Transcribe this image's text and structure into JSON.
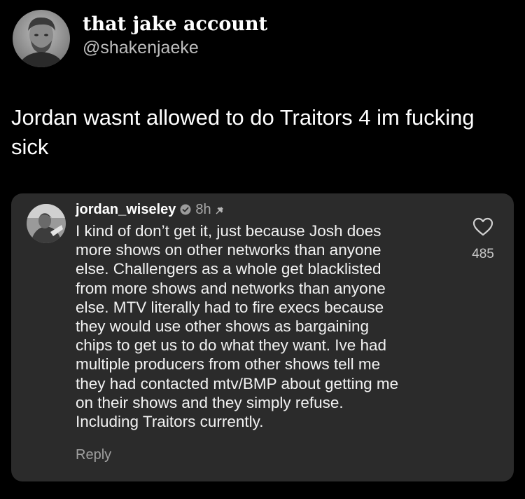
{
  "tweet": {
    "display_name": "that jake account",
    "handle": "@shakenjaeke",
    "text_lines": [
      "Jordan wasnt allowed to do Traitors 4 im fucking",
      "sick"
    ]
  },
  "comment": {
    "username": "jordan_wiseley",
    "verified_icon": "verified-badge-icon",
    "time": "8h",
    "pinned_icon": "pin-icon",
    "body_lines": [
      "I kind of don’t get it, just because Josh does",
      "more shows on other networks than anyone",
      "else. Challengers as a whole get blacklisted",
      "from more shows and networks than anyone",
      "else. MTV literally had to fire execs because",
      "they would use other shows as bargaining",
      "chips to get us to do what they want. Ive had",
      "multiple producers from other shows tell me",
      "they had contacted mtv/BMP about getting me",
      "on their shows and they simply refuse.",
      "Including Traitors currently."
    ],
    "reply_label": "Reply",
    "like_icon": "heart-icon",
    "like_count": "485"
  },
  "colors": {
    "background": "#000000",
    "card": "#2b2b2b",
    "primary_text": "#ffffff",
    "secondary_text": "#a9a9a9"
  }
}
